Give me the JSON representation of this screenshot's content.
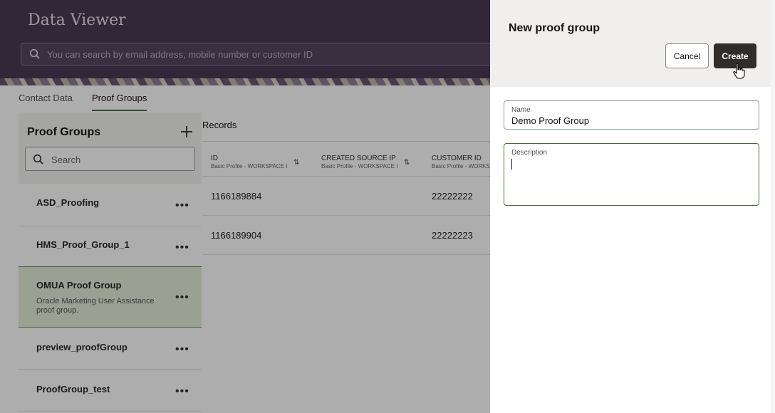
{
  "header": {
    "title": "Data Viewer",
    "search_placeholder": "You can search by email address, mobile number or customer ID"
  },
  "tabs": [
    {
      "label": "Contact Data"
    },
    {
      "label": "Proof Groups"
    }
  ],
  "proof_groups": {
    "title": "Proof Groups",
    "search_placeholder": "Search",
    "items": [
      {
        "name": "ASD_Proofing",
        "description": ""
      },
      {
        "name": "HMS_Proof_Group_1",
        "description": ""
      },
      {
        "name": "OMUA Proof Group",
        "description": "Oracle Marketing User Assistance proof group."
      },
      {
        "name": "preview_proofGroup",
        "description": ""
      },
      {
        "name": "ProofGroup_test",
        "description": ""
      }
    ]
  },
  "records": {
    "title": "Records",
    "columns": [
      {
        "name": "ID",
        "sub": "Basic Profile - WORKSPACE I"
      },
      {
        "name": "CREATED SOURCE IP",
        "sub": "Basic Profile - WORKSPACE I"
      },
      {
        "name": "CUSTOMER ID",
        "sub": "Basic Profile - WORKSPA"
      }
    ],
    "rows": [
      [
        "1166189884",
        "",
        "22222222"
      ],
      [
        "1166189904",
        "",
        "22222223"
      ]
    ]
  },
  "drawer": {
    "title": "New proof group",
    "cancel_label": "Cancel",
    "create_label": "Create",
    "name_label": "Name",
    "name_value": "Demo Proof Group",
    "description_label": "Description",
    "description_value": ""
  }
}
